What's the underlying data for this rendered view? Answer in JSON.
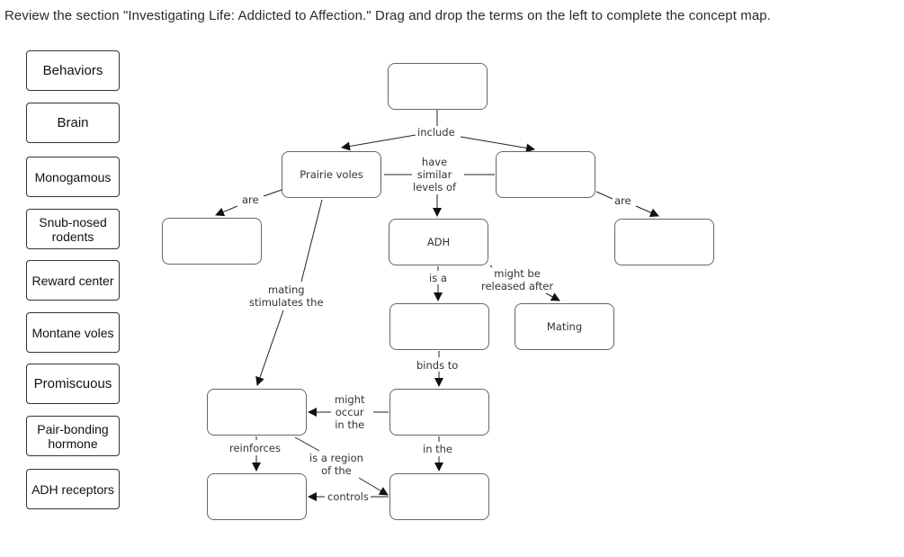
{
  "instruction": "Review the section \"Investigating Life: Addicted to Affection.\" Drag and drop the terms on the left to complete the concept map.",
  "terms": [
    {
      "label": "Behaviors"
    },
    {
      "label": "Brain"
    },
    {
      "label": "Monogamous"
    },
    {
      "label": "Snub-nosed rodents"
    },
    {
      "label": "Reward center"
    },
    {
      "label": "Montane voles"
    },
    {
      "label": "Promiscuous"
    },
    {
      "label": "Pair-bonding hormone"
    },
    {
      "label": "ADH receptors"
    }
  ],
  "nodes": {
    "top": "",
    "prairie_voles": "Prairie voles",
    "right_mid": "",
    "left_are": "",
    "adh": "ADH",
    "right_are": "",
    "is_a_target": "",
    "mating": "Mating",
    "stimulated": "",
    "binds_target": "",
    "reinforced": "",
    "region_of": ""
  },
  "link_labels": {
    "include": "include",
    "have_similar": "have\nsimilar\nlevels of",
    "are_left": "are",
    "are_right": "are",
    "is_a": "is a",
    "might_be_released": "might be\nreleased after",
    "mating_stimulates": "mating\nstimulates the",
    "binds_to": "binds to",
    "might_occur": "might\noccur\nin the",
    "reinforces": "reinforces",
    "is_a_region": "is a region\nof the",
    "in_the": "in the",
    "controls": "controls"
  }
}
